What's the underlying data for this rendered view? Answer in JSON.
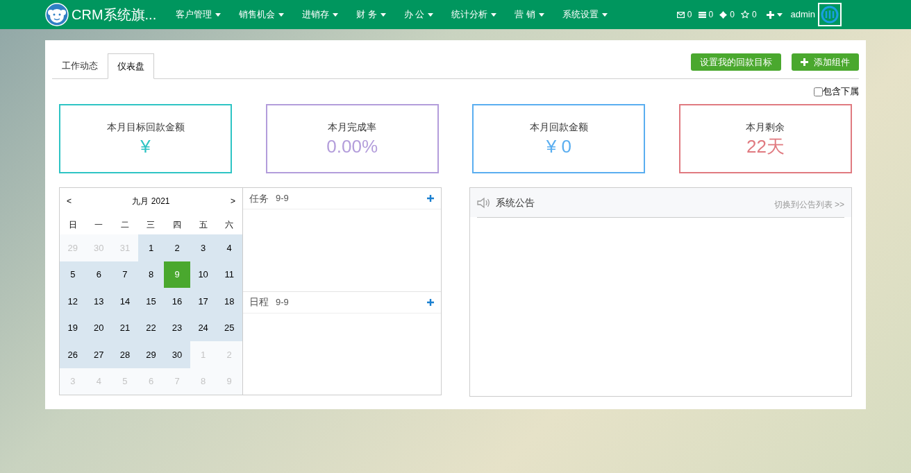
{
  "navbar": {
    "brand": "CRM系统旗...",
    "menus": [
      "客户管理",
      "销售机会",
      "进销存",
      "财 务",
      "办 公",
      "统计分析",
      "营 销",
      "系统设置"
    ],
    "counters": [
      {
        "kind": "mail",
        "count": "0"
      },
      {
        "kind": "list",
        "count": "0"
      },
      {
        "kind": "move",
        "count": "0"
      },
      {
        "kind": "star",
        "count": "0"
      }
    ],
    "user": "admin"
  },
  "tabs": [
    {
      "label": "工作动态",
      "selected": false
    },
    {
      "label": "仪表盘",
      "selected": true
    }
  ],
  "actions": [
    {
      "label": "设置我的回款目标",
      "kind": "plain"
    },
    {
      "label": "添加组件",
      "kind": "add"
    }
  ],
  "include_subordinates": {
    "label": "包含下属",
    "checked": false
  },
  "stat_cards": [
    {
      "title": "本月目标回款金额",
      "value": "¥",
      "color": "#2ec4c4"
    },
    {
      "title": "本月完成率",
      "value": "0.00%",
      "color": "#b39ddb"
    },
    {
      "title": "本月回款金额",
      "value": "¥ 0",
      "color": "#5aaef0"
    },
    {
      "title": "本月剩余",
      "value": "22天",
      "color": "#e07a80"
    }
  ],
  "calendar": {
    "prev": "<",
    "title": "九月 2021",
    "next": ">",
    "weekdays": [
      "日",
      "一",
      "二",
      "三",
      "四",
      "五",
      "六"
    ],
    "days": [
      {
        "label": "29",
        "outside": true,
        "selected": false
      },
      {
        "label": "30",
        "outside": true,
        "selected": false
      },
      {
        "label": "31",
        "outside": true,
        "selected": false
      },
      {
        "label": "1",
        "outside": false,
        "selected": false
      },
      {
        "label": "2",
        "outside": false,
        "selected": false
      },
      {
        "label": "3",
        "outside": false,
        "selected": false
      },
      {
        "label": "4",
        "outside": false,
        "selected": false
      },
      {
        "label": "5",
        "outside": false,
        "selected": false
      },
      {
        "label": "6",
        "outside": false,
        "selected": false
      },
      {
        "label": "7",
        "outside": false,
        "selected": false
      },
      {
        "label": "8",
        "outside": false,
        "selected": false
      },
      {
        "label": "9",
        "outside": false,
        "selected": true
      },
      {
        "label": "10",
        "outside": false,
        "selected": false
      },
      {
        "label": "11",
        "outside": false,
        "selected": false
      },
      {
        "label": "12",
        "outside": false,
        "selected": false
      },
      {
        "label": "13",
        "outside": false,
        "selected": false
      },
      {
        "label": "14",
        "outside": false,
        "selected": false
      },
      {
        "label": "15",
        "outside": false,
        "selected": false
      },
      {
        "label": "16",
        "outside": false,
        "selected": false
      },
      {
        "label": "17",
        "outside": false,
        "selected": false
      },
      {
        "label": "18",
        "outside": false,
        "selected": false
      },
      {
        "label": "19",
        "outside": false,
        "selected": false
      },
      {
        "label": "20",
        "outside": false,
        "selected": false
      },
      {
        "label": "21",
        "outside": false,
        "selected": false
      },
      {
        "label": "22",
        "outside": false,
        "selected": false
      },
      {
        "label": "23",
        "outside": false,
        "selected": false
      },
      {
        "label": "24",
        "outside": false,
        "selected": false
      },
      {
        "label": "25",
        "outside": false,
        "selected": false
      },
      {
        "label": "26",
        "outside": false,
        "selected": false
      },
      {
        "label": "27",
        "outside": false,
        "selected": false
      },
      {
        "label": "28",
        "outside": false,
        "selected": false
      },
      {
        "label": "29",
        "outside": false,
        "selected": false
      },
      {
        "label": "30",
        "outside": false,
        "selected": false
      },
      {
        "label": "1",
        "outside": true,
        "selected": false
      },
      {
        "label": "2",
        "outside": true,
        "selected": false
      },
      {
        "label": "3",
        "outside": true,
        "selected": false
      },
      {
        "label": "4",
        "outside": true,
        "selected": false
      },
      {
        "label": "5",
        "outside": true,
        "selected": false
      },
      {
        "label": "6",
        "outside": true,
        "selected": false
      },
      {
        "label": "7",
        "outside": true,
        "selected": false
      },
      {
        "label": "8",
        "outside": true,
        "selected": false
      },
      {
        "label": "9",
        "outside": true,
        "selected": false
      }
    ]
  },
  "agenda": [
    {
      "title": "任务",
      "date": "9-9"
    },
    {
      "title": "日程",
      "date": "9-9"
    }
  ],
  "announcements": {
    "title": "系统公告",
    "link": "切换到公告列表 >>"
  }
}
